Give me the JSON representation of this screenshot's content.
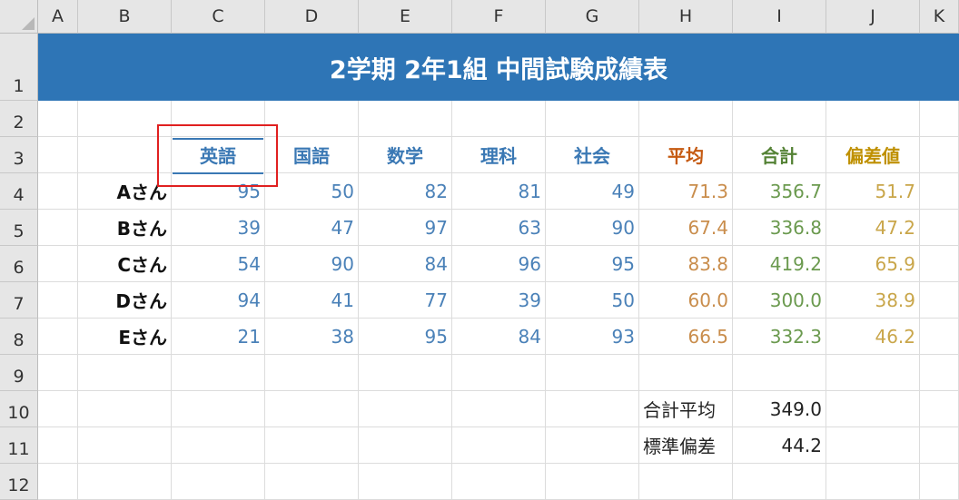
{
  "columns": [
    "A",
    "B",
    "C",
    "D",
    "E",
    "F",
    "G",
    "H",
    "I",
    "J",
    "K"
  ],
  "rows": [
    "1",
    "2",
    "3",
    "4",
    "5",
    "6",
    "7",
    "8",
    "9",
    "10",
    "11",
    "12"
  ],
  "title": "2学期 2年1組 中間試験成績表",
  "headers": {
    "english": "英語",
    "japanese": "国語",
    "math": "数学",
    "science": "理科",
    "social": "社会",
    "average": "平均",
    "total": "合計",
    "deviation": "偏差値"
  },
  "students": [
    {
      "name": "Aさん",
      "english": "95",
      "japanese": "50",
      "math": "82",
      "science": "81",
      "social": "49",
      "average": "71.3",
      "total": "356.7",
      "deviation": "51.7"
    },
    {
      "name": "Bさん",
      "english": "39",
      "japanese": "47",
      "math": "97",
      "science": "63",
      "social": "90",
      "average": "67.4",
      "total": "336.8",
      "deviation": "47.2"
    },
    {
      "name": "Cさん",
      "english": "54",
      "japanese": "90",
      "math": "84",
      "science": "96",
      "social": "95",
      "average": "83.8",
      "total": "419.2",
      "deviation": "65.9"
    },
    {
      "name": "Dさん",
      "english": "94",
      "japanese": "41",
      "math": "77",
      "science": "39",
      "social": "50",
      "average": "60.0",
      "total": "300.0",
      "deviation": "38.9"
    },
    {
      "name": "Eさん",
      "english": "21",
      "japanese": "38",
      "math": "95",
      "science": "84",
      "social": "93",
      "average": "66.5",
      "total": "332.3",
      "deviation": "46.2"
    }
  ],
  "summary": {
    "total_avg_label": "合計平均",
    "total_avg_value": "349.0",
    "std_label": "標準偏差",
    "std_value": "44.2"
  },
  "colors": {
    "title_band": "#2e75b6",
    "subject_blue": "#3a78b4",
    "average_orange": "#c55a11",
    "total_green": "#548235",
    "deviation_gold": "#bf9000",
    "selection_border": "#e02020"
  }
}
